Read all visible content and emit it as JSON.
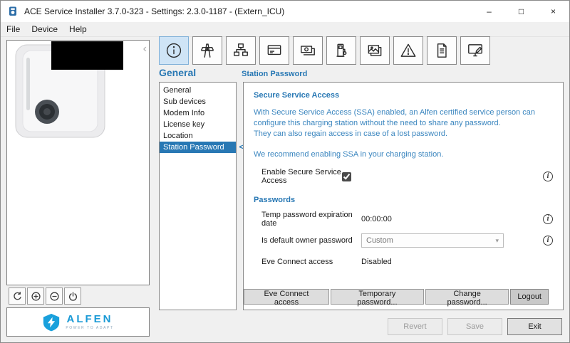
{
  "window": {
    "title": "ACE Service Installer 3.7.0-323 - Settings: 2.3.0-1187 - (Extern_ICU)",
    "minimize": "–",
    "maximize": "□",
    "close": "×"
  },
  "menu": {
    "file": "File",
    "device": "Device",
    "help": "Help"
  },
  "device_panel": {
    "collapse_chevron": "‹",
    "controls": [
      "refresh",
      "zoom-in",
      "zoom-out",
      "power"
    ],
    "logo_brand": "ALFEN",
    "logo_tagline": "POWER TO ADAPT"
  },
  "toolbar": {
    "icons": [
      "general-info",
      "energy-grid",
      "sub-devices",
      "display-card",
      "payment",
      "charging-socket",
      "images",
      "warnings",
      "logs",
      "remote-screen"
    ],
    "selected": "general-info"
  },
  "page": {
    "title": "General",
    "subtitle": "Station Password"
  },
  "subnav": {
    "items": [
      "General",
      "Sub devices",
      "Modem Info",
      "License key",
      "Location",
      "Station Password"
    ],
    "selected_index": 5,
    "selected_chevron": "<"
  },
  "content": {
    "ssa_heading": "Secure Service Access",
    "ssa_lines": [
      "With Secure Service Access (SSA) enabled, an Alfen certified service person can",
      "configure this charging station without the need to share any password.",
      "They can also regain access in case of a lost password."
    ],
    "ssa_recommendation": "We recommend enabling SSA in your charging station.",
    "enable_label": "Enable Secure Service Access",
    "enable_checked": true,
    "passwords_heading": "Passwords",
    "temp_password_label": "Temp password expiration date",
    "temp_password_value": "00:00:00",
    "owner_password_label": "Is default owner password",
    "owner_password_value": "Custom",
    "eve_access_label": "Eve Connect access",
    "eve_access_value": "Disabled",
    "action_buttons": [
      "Eve Connect access",
      "Temporary password...",
      "Change password...",
      "Logout"
    ]
  },
  "footer": {
    "revert": "Revert",
    "save": "Save",
    "exit": "Exit"
  },
  "colors": {
    "accent_blue": "#2878b4",
    "nav_selected_bg": "#2878b4",
    "toolbar_selected_bg": "#cfe4f6",
    "logo_blue": "#1a9ad6"
  }
}
